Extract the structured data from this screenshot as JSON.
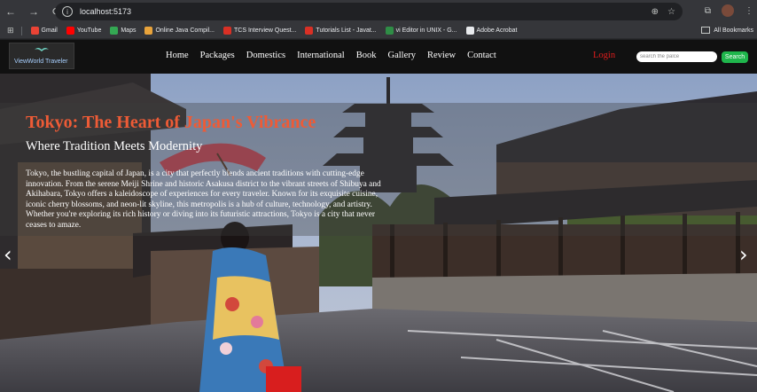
{
  "browser": {
    "url": "localhost:5173",
    "icons": [
      "back-icon",
      "forward-icon",
      "reload-icon",
      "site-info-icon",
      "zoom-icon",
      "bookmark-star-icon",
      "extensions-icon",
      "profile-avatar",
      "menu-icon"
    ]
  },
  "bookmarks": {
    "items": [
      {
        "label": "Gmail",
        "color": "#ea4335"
      },
      {
        "label": "YouTube",
        "color": "#ff0000"
      },
      {
        "label": "Maps",
        "color": "#34a853"
      },
      {
        "label": "Online Java Compil...",
        "color": "#e8a33b"
      },
      {
        "label": "TCS Interview Quest...",
        "color": "#d93025"
      },
      {
        "label": "Tutorials List - Javat...",
        "color": "#d93025"
      },
      {
        "label": "vi Editor in UNIX - G...",
        "color": "#2f8d46"
      },
      {
        "label": "Adobe Acrobat",
        "color": "#e8eaed"
      }
    ],
    "all_label": "All Bookmarks"
  },
  "site": {
    "logo_text": "ViewWorld Traveler",
    "menu": [
      "Home",
      "Packages",
      "Domestics",
      "International",
      "Book",
      "Gallery",
      "Review",
      "Contact"
    ],
    "login_label": "Login",
    "search_placeholder": "search the palce",
    "search_button": "Search"
  },
  "hero": {
    "title": "Tokyo: The Heart of Japan's Vibrance",
    "subtitle": "Where Tradition Meets Modernity",
    "description": "Tokyo, the bustling capital of Japan, is a city that perfectly blends ancient traditions with cutting-edge innovation. From the serene Meiji Shrine and historic Asakusa district to the vibrant streets of Shibuya and Akihabara, Tokyo offers a kaleidoscope of experiences for every traveler. Known for its exquisite cuisine, iconic cherry blossoms, and neon-lit skyline, this metropolis is a hub of culture, technology, and artistry. Whether you're exploring its rich history or diving into its futuristic attractions, Tokyo is a city that never ceases to amaze.",
    "prev_arrow": "‹",
    "next_arrow": "›"
  },
  "colors": {
    "title": "#ee5b36",
    "login": "#e01d1d",
    "search_button": "#1fb64c"
  }
}
